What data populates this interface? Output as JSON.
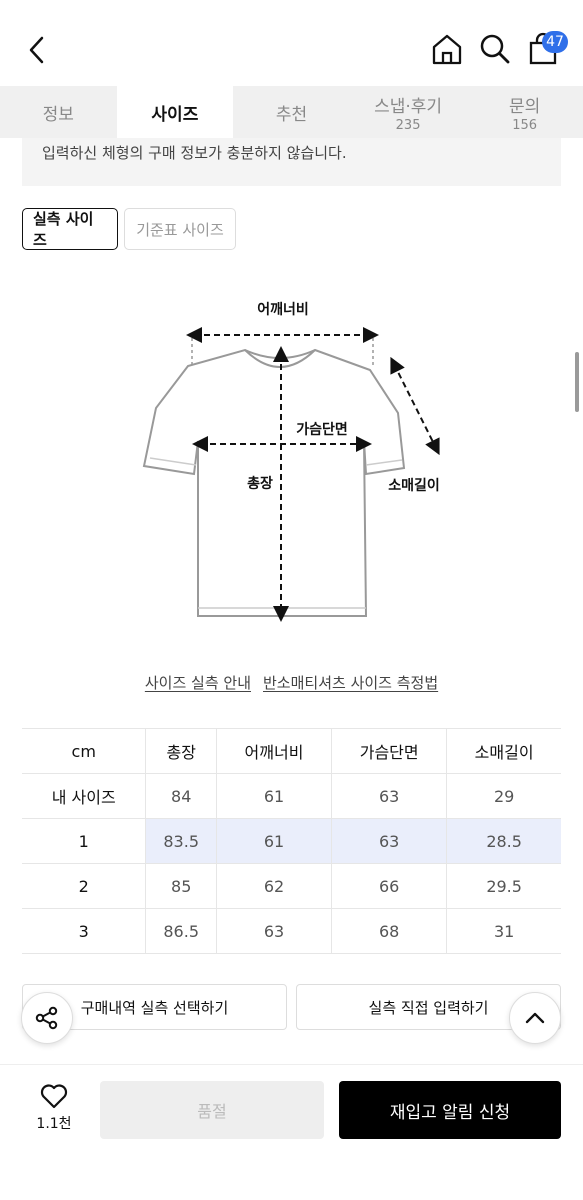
{
  "header": {
    "cart_count": "47",
    "icons": {
      "back": "chevron-left-icon",
      "home": "home-icon",
      "search": "search-icon",
      "cart": "shopping-bag-icon"
    }
  },
  "tabs": [
    {
      "label": "정보",
      "count": ""
    },
    {
      "label": "사이즈",
      "count": ""
    },
    {
      "label": "추천",
      "count": ""
    },
    {
      "label": "스냅·후기",
      "count": "235"
    },
    {
      "label": "문의",
      "count": "156"
    }
  ],
  "active_tab": "사이즈",
  "notice": "입력하신 체형의 구매 정보가 충분하지 않습니다.",
  "size_toggle": {
    "actual": "실측 사이즈",
    "standard": "기준표 사이즈"
  },
  "diagram": {
    "shoulder": "어깨너비",
    "chest": "가슴단면",
    "length": "총장",
    "sleeve": "소매길이"
  },
  "guide_links": [
    "사이즈 실측 안내",
    "반소매티셔츠 사이즈 측정법"
  ],
  "size_table": {
    "headers": [
      "cm",
      "총장",
      "어깨너비",
      "가슴단면",
      "소매길이"
    ],
    "rows": [
      [
        "내 사이즈",
        "84",
        "61",
        "63",
        "29"
      ],
      [
        "1",
        "83.5",
        "61",
        "63",
        "28.5"
      ],
      [
        "2",
        "85",
        "62",
        "66",
        "29.5"
      ],
      [
        "3",
        "86.5",
        "63",
        "68",
        "31"
      ]
    ],
    "selected_row": "1"
  },
  "actions": {
    "purchase_select": "구매내역 실측 선택하기",
    "direct_input": "실측 직접 입력하기"
  },
  "bottom": {
    "like_count": "1.1천",
    "soldout": "품절",
    "restock": "재입고 알림 신청"
  },
  "colors": {
    "badge": "#2f6fe9",
    "selected_row": "#eaeefb",
    "primary_button": "#000000"
  }
}
